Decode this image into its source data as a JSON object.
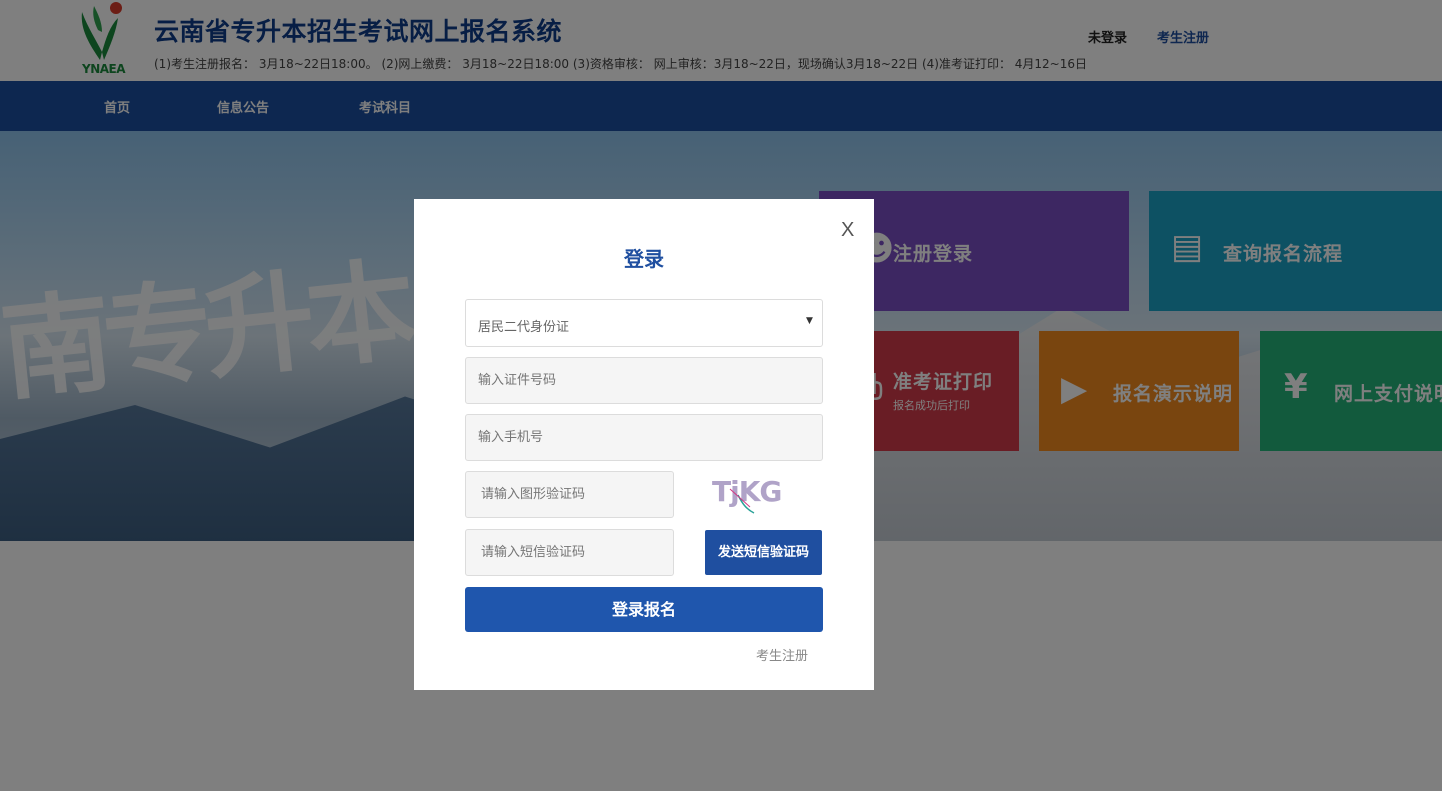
{
  "header": {
    "logo_text": "YNAEA",
    "site_title": "云南省专升本招生考试网上报名系统",
    "schedule": "(1)考生注册报名： 3月18~22日18:00。 (2)网上缴费： 3月18~22日18:00 (3)资格审核： 网上审核：3月18~22日，现场确认3月18~22日 (4)准考证打印： 4月12~16日",
    "user_status": "未登录",
    "register_link": "考生注册"
  },
  "nav": {
    "items": [
      {
        "label": "首页"
      },
      {
        "label": "信息公告"
      },
      {
        "label": "考试科目"
      }
    ]
  },
  "banner": {
    "calligraphy": "南专升本",
    "tiles": [
      {
        "label": "注册登录",
        "icon": "user-icon",
        "color": "#7b4fc4"
      },
      {
        "label": "查询报名流程",
        "icon": "document-icon",
        "color": "#1aa3c7"
      },
      {
        "label": "准考证打印",
        "sub": "报名成功后打印",
        "icon": "print-icon",
        "color": "#d33b4a"
      },
      {
        "label": "报名演示说明",
        "icon": "play-icon",
        "color": "#f28a1e"
      },
      {
        "label": "网上支付说明",
        "icon": "yuan-icon",
        "color": "#24b57a"
      }
    ]
  },
  "modal": {
    "close": "X",
    "title": "登录",
    "id_type": "居民二代身份证",
    "id_number_placeholder": "输入证件号码",
    "phone_placeholder": "输入手机号",
    "captcha_placeholder": "请输入图形验证码",
    "captcha_text": "TjKG",
    "sms_placeholder": "请输入短信验证码",
    "sms_button": "发送短信验证码",
    "submit_button": "登录报名",
    "register_link": "考生注册"
  },
  "colors": {
    "brand_blue": "#1f4fa0",
    "nav_blue": "#1a4fa0"
  }
}
